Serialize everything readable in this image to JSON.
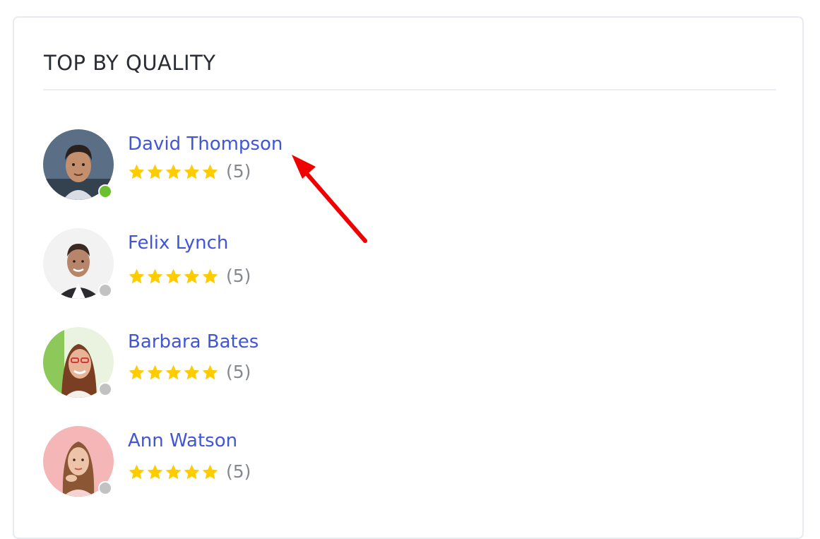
{
  "panel": {
    "title": "TOP BY QUALITY"
  },
  "colors": {
    "name_link": "#4156d6",
    "star": "#ffcc00",
    "online": "#6cc02d",
    "offline": "#c2c2c2",
    "annotation_arrow": "#f00000"
  },
  "users": [
    {
      "name": "David Thompson",
      "rating": 5,
      "count_label": "(5)",
      "status": "online"
    },
    {
      "name": "Felix Lynch",
      "rating": 5,
      "count_label": "(5)",
      "status": "offline"
    },
    {
      "name": "Barbara Bates",
      "rating": 5,
      "count_label": "(5)",
      "status": "offline"
    },
    {
      "name": "Ann Watson",
      "rating": 5,
      "count_label": "(5)",
      "status": "offline"
    }
  ]
}
